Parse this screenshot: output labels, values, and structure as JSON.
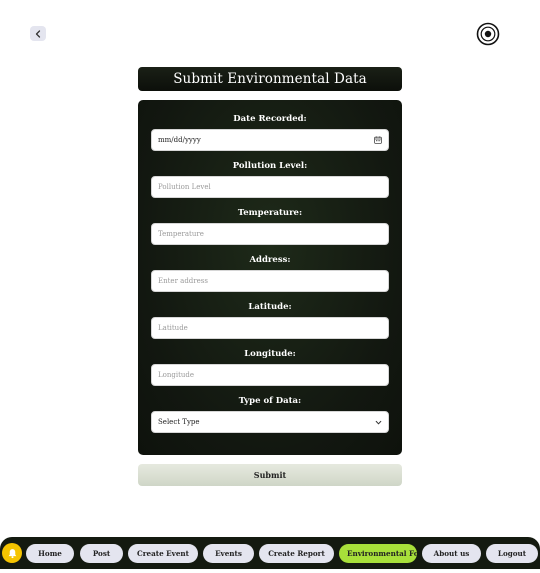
{
  "header": {
    "back_icon": "chevron-left-icon",
    "target_icon": "target-icon"
  },
  "form": {
    "title": "Submit Environmental Data",
    "fields": {
      "date": {
        "label": "Date Recorded:",
        "placeholder": "mm/dd/yyyy",
        "icon": "calendar-icon"
      },
      "pollution": {
        "label": "Pollution Level:",
        "placeholder": "Pollution Level"
      },
      "temperature": {
        "label": "Temperature:",
        "placeholder": "Temperature"
      },
      "address": {
        "label": "Address:",
        "placeholder": "Enter address"
      },
      "latitude": {
        "label": "Latitude:",
        "placeholder": "Latitude"
      },
      "longitude": {
        "label": "Longitude:",
        "placeholder": "Longitude"
      },
      "type": {
        "label": "Type of Data:",
        "selected": "Select Type",
        "icon": "chevron-down-icon"
      }
    },
    "submit_label": "Submit"
  },
  "nav": {
    "bell_icon": "bell-icon",
    "items": [
      {
        "label": "Home"
      },
      {
        "label": "Post"
      },
      {
        "label": "Create Event"
      },
      {
        "label": "Events"
      },
      {
        "label": "Create Report"
      },
      {
        "label": "Environmental Form",
        "active": true
      },
      {
        "label": "About us"
      },
      {
        "label": "Logout"
      }
    ]
  },
  "colors": {
    "card_dark": "#121710",
    "nav_bg": "#141a10",
    "active_nav": "#a8e03a",
    "bell": "#f5c400",
    "pill": "#e4e5ef"
  }
}
